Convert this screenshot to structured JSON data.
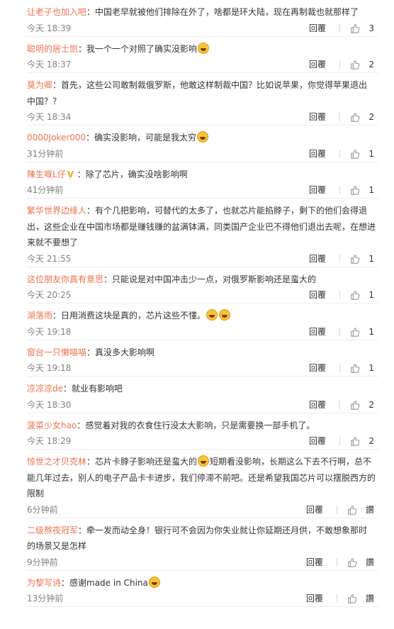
{
  "labels": {
    "reply": "回覆"
  },
  "comments": [
    {
      "author": "让老子也加入吧",
      "text": "：中国老早就被他们排除在外了，啥都是环大陆，现在再制裁也就那样了",
      "time": "今天 18:39",
      "likes": "3"
    },
    {
      "author": "聪明的居士凯",
      "text": "：我一个一个对照了确实没影响",
      "emoji_after": [
        "grin-emoji"
      ],
      "time": "今天 18:37",
      "likes": "2"
    },
    {
      "author": "莫为卿",
      "text": "：首先，这些公司敢制裁俄罗斯，他敢这样制裁中国？比如说苹果，你觉得苹果退出中国？？",
      "time": "今天 18:34",
      "likes": "2"
    },
    {
      "author": "0000Joker000",
      "text": "：确实没影响，可能是我太穷",
      "emoji_after": [
        "laugh-tears-emoji"
      ],
      "time": "31分钟前",
      "likes": "1"
    },
    {
      "author": "陳生嘅L仔",
      "badge": "V",
      "text": "：除了芯片，确实没啥影响啊",
      "time": "41分钟前",
      "likes": "1"
    },
    {
      "author": "繁华世界边缘人",
      "text": "：有个几把影响，可替代的太多了，也就芯片能掐脖子，剩下的他们会得退出，这些企业在中国市场都是赚钱赚的盆满钵满，同类国产企业巴不得他们退出去呢，在想进来就不要想了",
      "time": "今天 21:55",
      "likes": "1"
    },
    {
      "author": "这位朋友你真有意思",
      "text": "：只能说是对中国冲击少一点，对俄罗斯影响还是蛮大的",
      "time": "今天 20:25",
      "likes": "1"
    },
    {
      "author": "湖落雨",
      "text": "：日用消费这块是真的，芯片这些不懂。",
      "emoji_after": [
        "laugh-emoji",
        "laugh-emoji"
      ],
      "time": "今天 19:18",
      "likes": "1"
    },
    {
      "author": "窗台一只懒喵喵",
      "text": "：真没多大影响啊",
      "time": "今天 19:18",
      "likes": "1"
    },
    {
      "author": "凉凉凉de",
      "text": "：就业有影响吧",
      "time": "今天 18:30",
      "likes": "2"
    },
    {
      "author": "菠菜少女hao",
      "text": "：感觉着对我的衣食住行没太大影响，只是需要换一部手机了。",
      "time": "今天 18:29",
      "likes": "2"
    },
    {
      "author": "惊世之才贝克林",
      "text": "：芯片卡脖子影响还是蛮大的",
      "emoji_mid": "laugh-tears-emoji",
      "text2": "短期看没影响，长期这么下去不行啊，总不能几年过去，别人的电子产品卡卡进步，我们停滞不前吧。还是希望我国芯片可以摆脱西方的限制",
      "time": "6分钟前",
      "likes": "讚"
    },
    {
      "author": "二级熬夜冠军",
      "text": "：牵一发而动全身！银行可不会因为你失业就让你延期还月供，不敢想象那时的场景又是怎样",
      "time": "9分钟前",
      "likes": "讚"
    },
    {
      "author": "为黎写诗",
      "text": "：感谢made in China",
      "emoji_after": [
        "cry-emoji"
      ],
      "time": "13分钟前",
      "likes": "讚"
    }
  ]
}
